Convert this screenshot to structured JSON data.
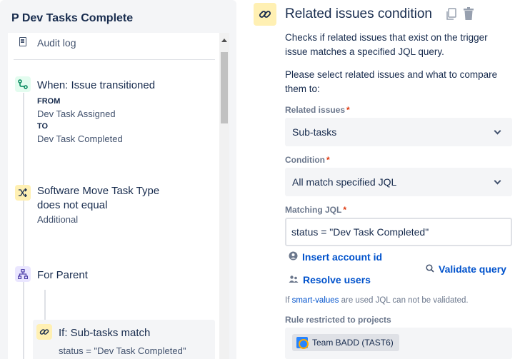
{
  "rule": {
    "title": "P Dev Tasks Complete"
  },
  "sidebar": {
    "audit_log": "Audit log",
    "trigger": {
      "title": "When: Issue transitioned",
      "from_label": "FROM",
      "from_value": "Dev Task Assigned",
      "to_label": "TO",
      "to_value": "Dev Task Completed"
    },
    "condition_node": {
      "title_line1": "Software Move Task Type",
      "title_line2": "does not equal",
      "value": "Additional"
    },
    "branch_node": {
      "title": "For Parent"
    },
    "if_node": {
      "title": "If: Sub-tasks match",
      "query": "status = \"Dev Task Completed\""
    }
  },
  "panel": {
    "title": "Related issues condition",
    "description": [
      "Checks if related issues that exist on the trigger",
      "issue matches a specified JQL query."
    ],
    "instruction": [
      "Please select related issues and what to compare",
      "them to:"
    ],
    "related_issues": {
      "label": "Related issues",
      "required": "*",
      "value": "Sub-tasks"
    },
    "condition": {
      "label": "Condition",
      "required": "*",
      "value": "All match specified JQL"
    },
    "matching_jql": {
      "label": "Matching JQL",
      "required": "*",
      "value": "status = \"Dev Task Completed\""
    },
    "insert_account_id": "Insert account id",
    "resolve_users": "Resolve users",
    "validate_query": "Validate query",
    "hint": {
      "prefix": "If ",
      "smart_values": "smart-values",
      "suffix": " are used JQL can not be validated."
    },
    "restricted": {
      "label": "Rule restricted to projects",
      "project": "Team BADD (TAST6)"
    }
  },
  "colors": {
    "accent": "#0052cc",
    "required": "#de350b",
    "condition_icon_bg": "#fff0b3"
  }
}
